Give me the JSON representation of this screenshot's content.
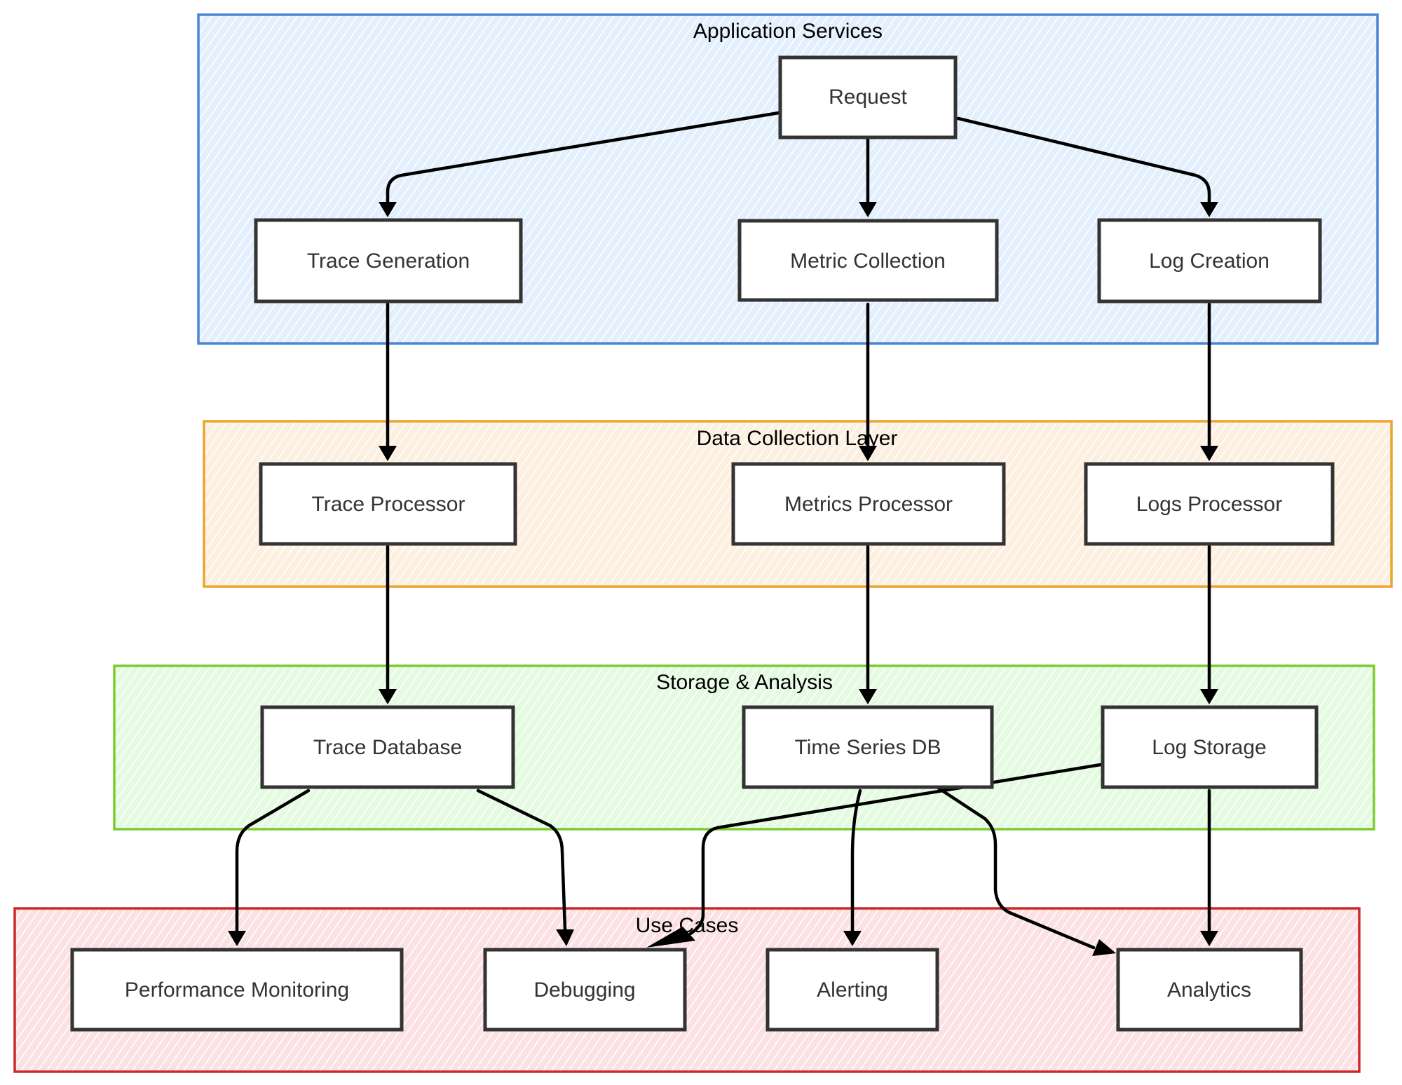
{
  "diagram": {
    "type": "flowchart",
    "direction": "top-to-bottom",
    "clusters": [
      {
        "id": "app",
        "label": "Application Services",
        "stroke": "#4a86d4",
        "fill": "#e3effc",
        "hatch": "#ffffff"
      },
      {
        "id": "collect",
        "label": "Data Collection Layer",
        "stroke": "#eba52e",
        "fill": "#fdf0e0",
        "hatch": "#ffffff"
      },
      {
        "id": "storage",
        "label": "Storage & Analysis",
        "stroke": "#7ccb2e",
        "fill": "#e4fbe1",
        "hatch": "#ffffff"
      },
      {
        "id": "usecases",
        "label": "Use Cases",
        "stroke": "#cc2a2a",
        "fill": "#fbe1e3",
        "hatch": "#ffffff"
      }
    ],
    "nodes": [
      {
        "id": "request",
        "label": "Request",
        "cluster": "app"
      },
      {
        "id": "trace_gen",
        "label": "Trace Generation",
        "cluster": "app"
      },
      {
        "id": "metric_col",
        "label": "Metric Collection",
        "cluster": "app"
      },
      {
        "id": "log_create",
        "label": "Log Creation",
        "cluster": "app"
      },
      {
        "id": "trace_proc",
        "label": "Trace Processor",
        "cluster": "collect"
      },
      {
        "id": "metrics_proc",
        "label": "Metrics Processor",
        "cluster": "collect"
      },
      {
        "id": "logs_proc",
        "label": "Logs Processor",
        "cluster": "collect"
      },
      {
        "id": "trace_db",
        "label": "Trace Database",
        "cluster": "storage"
      },
      {
        "id": "tsdb",
        "label": "Time Series DB",
        "cluster": "storage"
      },
      {
        "id": "log_storage",
        "label": "Log Storage",
        "cluster": "storage"
      },
      {
        "id": "perf_mon",
        "label": "Performance Monitoring",
        "cluster": "usecases"
      },
      {
        "id": "debugging",
        "label": "Debugging",
        "cluster": "usecases"
      },
      {
        "id": "alerting",
        "label": "Alerting",
        "cluster": "usecases"
      },
      {
        "id": "analytics",
        "label": "Analytics",
        "cluster": "usecases"
      }
    ],
    "edges": [
      {
        "from": "request",
        "to": "trace_gen"
      },
      {
        "from": "request",
        "to": "metric_col"
      },
      {
        "from": "request",
        "to": "log_create"
      },
      {
        "from": "trace_gen",
        "to": "trace_proc"
      },
      {
        "from": "metric_col",
        "to": "metrics_proc"
      },
      {
        "from": "log_create",
        "to": "logs_proc"
      },
      {
        "from": "trace_proc",
        "to": "trace_db"
      },
      {
        "from": "metrics_proc",
        "to": "tsdb"
      },
      {
        "from": "logs_proc",
        "to": "log_storage"
      },
      {
        "from": "trace_db",
        "to": "perf_mon"
      },
      {
        "from": "trace_db",
        "to": "debugging"
      },
      {
        "from": "tsdb",
        "to": "alerting"
      },
      {
        "from": "tsdb",
        "to": "analytics"
      },
      {
        "from": "log_storage",
        "to": "debugging"
      },
      {
        "from": "log_storage",
        "to": "analytics"
      }
    ]
  }
}
